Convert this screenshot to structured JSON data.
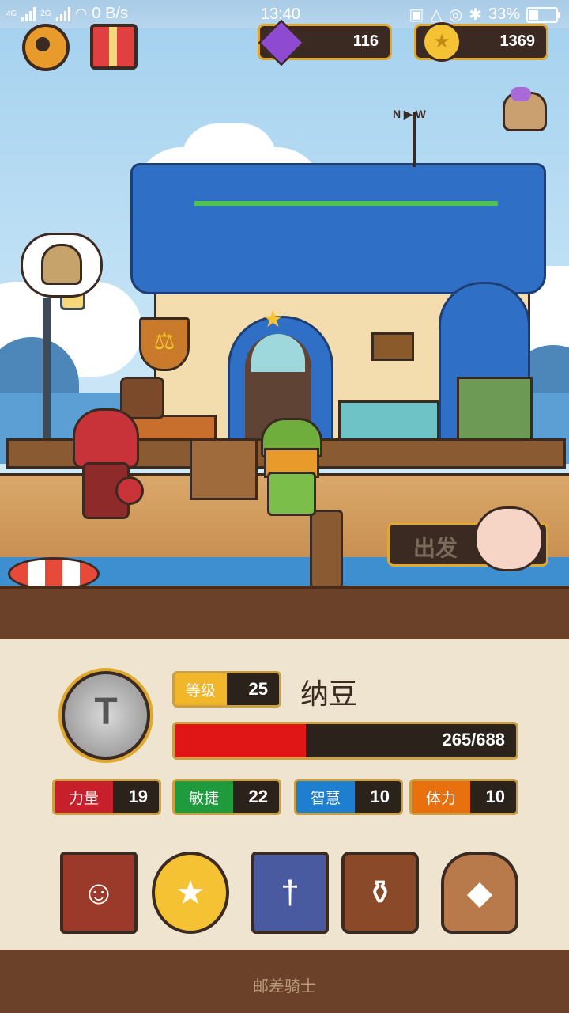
{
  "status_bar": {
    "net1": "4G",
    "net2": "2G",
    "speed": "0 B/s",
    "time": "13:40",
    "battery": "33%",
    "battery_level": 0.33
  },
  "top": {
    "gems": "116",
    "coins": "1369"
  },
  "scene": {
    "depart_label": "出发"
  },
  "character": {
    "level_label": "等级",
    "level": "25",
    "name": "纳豆",
    "hp_text": "265/688",
    "hp_fraction": 0.385
  },
  "stats": [
    {
      "label": "力量",
      "value": "19",
      "color": "#c8202a"
    },
    {
      "label": "敏捷",
      "value": "22",
      "color": "#1f9a3c"
    },
    {
      "label": "智慧",
      "value": "10",
      "color": "#1e7fd0"
    },
    {
      "label": "体力",
      "value": "10",
      "color": "#e8700e"
    }
  ],
  "menu": [
    "book-icon",
    "star-coin-icon",
    "cards-icon",
    "backpack-icon",
    "treasure-bag-icon"
  ],
  "footer": {
    "title": "邮差骑士"
  }
}
